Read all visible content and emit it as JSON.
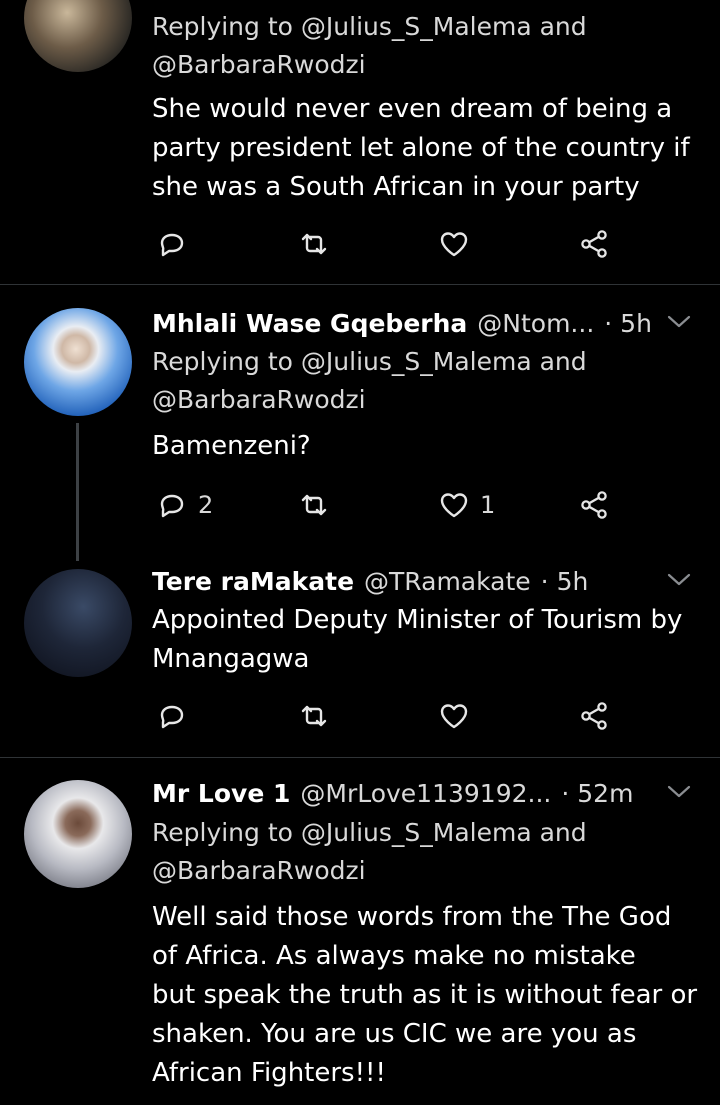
{
  "tweets": [
    {
      "replying_prefix": "Replying to",
      "replying_user1": "@Julius_S_Malema",
      "replying_and": "and",
      "replying_user2": "@BarbaraRwodzi",
      "text_lines": [
        "She would never even dream of being a",
        "party president let alone of the country if",
        "she was a South African in your party"
      ],
      "reply_count": "",
      "like_count": ""
    },
    {
      "name": "Mhlali Wase Gqeberha",
      "handle": "@Ntom...",
      "time": "· 5h",
      "replying_prefix": "Replying to",
      "replying_user1": "@Julius_S_Malema",
      "replying_and": "and",
      "replying_user2": "@BarbaraRwodzi",
      "text_lines": [
        "Bamenzeni?"
      ],
      "reply_count": "2",
      "like_count": "1"
    },
    {
      "name": "Tere raMakate",
      "handle": "@TRamakate",
      "time": "· 5h",
      "text_lines": [
        "Appointed Deputy Minister of Tourism by",
        "Mnangagwa"
      ],
      "reply_count": "",
      "like_count": ""
    },
    {
      "name": "Mr Love 1",
      "handle": "@MrLove1139192...",
      "time": "· 52m",
      "replying_prefix": "Replying to",
      "replying_user1": "@Julius_S_Malema",
      "replying_and": "and",
      "replying_user2": "@BarbaraRwodzi",
      "text_lines": [
        "Well said those words from the The God",
        "of Africa. As always make no mistake",
        "but speak the truth as it is without fear or",
        "shaken. You are us CIC we are you as",
        "African Fighters!!!"
      ]
    }
  ],
  "icons": {
    "reply": "reply-icon",
    "retweet": "retweet-icon",
    "like": "heart-icon",
    "share": "share-icon",
    "caret": "chevron-down-icon"
  },
  "colors": {
    "background": "#000000",
    "text": "#ffffff",
    "secondary": "#d9d9d9",
    "divider": "#2f3336"
  }
}
